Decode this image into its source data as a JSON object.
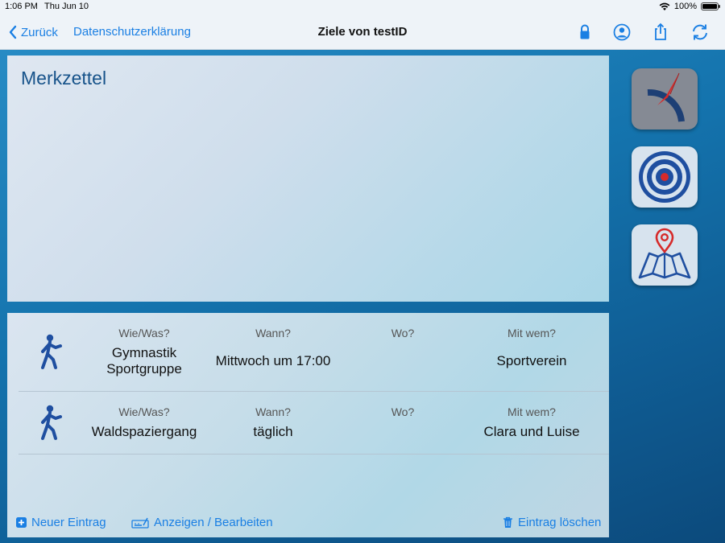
{
  "status": {
    "time": "1:06 PM",
    "date": "Thu Jun 10",
    "battery": "100%"
  },
  "nav": {
    "back_label": "Zurück",
    "privacy_label": "Datenschutzerklärung",
    "title": "Ziele von testID",
    "icons": [
      "lock-icon",
      "user-circle-icon",
      "share-icon",
      "sync-icon"
    ]
  },
  "notes": {
    "title": "Merkzettel"
  },
  "entries": [
    {
      "icon": "walking-person-icon",
      "how_header": "Wie/Was?",
      "how_line1": "Gymnastik",
      "how_line2": "Sportgruppe",
      "when_header": "Wann?",
      "when": "Mittwoch um 17:00",
      "where_header": "Wo?",
      "where": "",
      "with_header": "Mit wem?",
      "with": "Sportverein"
    },
    {
      "icon": "walking-person-icon",
      "how_header": "Wie/Was?",
      "how_line1": "Waldspaziergang",
      "how_line2": "",
      "when_header": "Wann?",
      "when": "täglich",
      "where_header": "Wo?",
      "where": "",
      "with_header": "Mit wem?",
      "with": "Clara und Luise"
    }
  ],
  "footer": {
    "new_entry": "Neuer Eintrag",
    "show_edit": "Anzeigen / Bearbeiten",
    "delete_entry": "Eintrag löschen"
  },
  "side_apps": [
    "gauge-app-icon",
    "target-app-icon",
    "map-pin-app-icon"
  ],
  "colors": {
    "accent": "#1a7fe3",
    "title_blue": "#17538a",
    "icon_blue": "#1f4fa0",
    "alert_red": "#d62a2a"
  }
}
